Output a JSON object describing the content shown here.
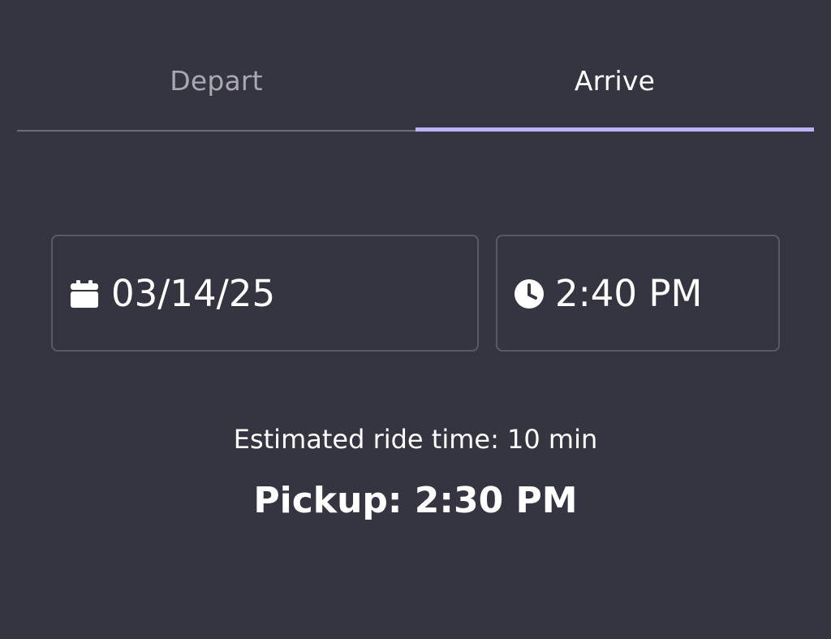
{
  "tabs": {
    "depart_label": "Depart",
    "arrive_label": "Arrive",
    "selected": "Arrive"
  },
  "date_field": {
    "icon": "calendar-icon",
    "value": "03/14/25"
  },
  "time_field": {
    "icon": "clock-icon",
    "value": "2:40 PM"
  },
  "estimate_text": "Estimated ride time: 10 min",
  "pickup_text": "Pickup: 2:30 PM",
  "colors": {
    "background": "#353441",
    "accent": "#bcb2f5",
    "field_border": "#5a5966",
    "inactive_text": "#a9a8b2"
  }
}
